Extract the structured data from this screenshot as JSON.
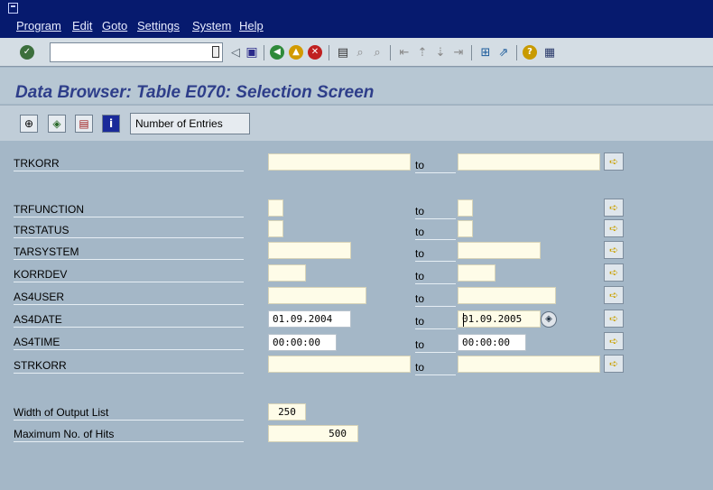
{
  "menu": {
    "items": [
      "Program",
      "Edit",
      "Goto",
      "Settings",
      "System",
      "Help"
    ]
  },
  "toolbar": {
    "command_field": "",
    "icons": [
      "enter-icon",
      "save-icon",
      "back-icon",
      "exit-icon",
      "cancel-icon",
      "print-icon",
      "find-icon",
      "find-next-icon",
      "first-page-icon",
      "previous-page-icon",
      "next-page-icon",
      "last-page-icon",
      "new-session-icon",
      "shortcut-icon",
      "help-icon",
      "layout-icon"
    ]
  },
  "title": "Data Browser: Table E070: Selection Screen",
  "app_toolbar": {
    "number_of_entries": "Number of Entries",
    "icons": [
      "execute-icon",
      "variant-icon",
      "save-variant-icon",
      "info-icon"
    ]
  },
  "form": {
    "to_label": "to",
    "rows": [
      {
        "label": "TRKORR",
        "from": "",
        "to": ""
      },
      {
        "label": "TRFUNCTION",
        "from": "",
        "to": ""
      },
      {
        "label": "TRSTATUS",
        "from": "",
        "to": ""
      },
      {
        "label": "TARSYSTEM",
        "from": "",
        "to": ""
      },
      {
        "label": "KORRDEV",
        "from": "",
        "to": ""
      },
      {
        "label": "AS4USER",
        "from": "",
        "to": ""
      },
      {
        "label": "AS4DATE",
        "from": "01.09.2004",
        "to": "01.09.2005"
      },
      {
        "label": "AS4TIME",
        "from": "00:00:00",
        "to": "00:00:00"
      },
      {
        "label": "STRKORR",
        "from": "",
        "to": ""
      }
    ],
    "width_label": "Width of Output List",
    "width_value": "250",
    "max_hits_label": "Maximum No. of Hits",
    "max_hits_value": "500"
  },
  "colors": {
    "menubar": "#061a6e",
    "background": "#a4b7c7",
    "title": "#2e3e8a",
    "input_bg": "#fefce8"
  }
}
